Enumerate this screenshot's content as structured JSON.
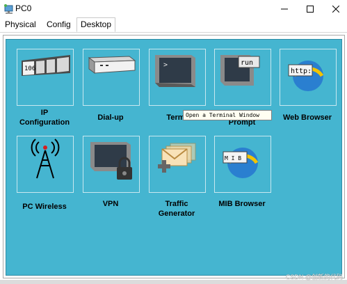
{
  "window": {
    "title": "PC0"
  },
  "tabs": [
    {
      "label": "Physical"
    },
    {
      "label": "Config"
    },
    {
      "label": "Desktop"
    }
  ],
  "active_tab": "Desktop",
  "desktop": {
    "apps": [
      {
        "id": "ip-configuration",
        "label_lines": [
          "IP",
          "Configuration"
        ],
        "icon": "ip-config-icon",
        "icon_text": "106"
      },
      {
        "id": "dial-up",
        "label_lines": [
          "Dial-up"
        ],
        "icon": "modem-icon"
      },
      {
        "id": "terminal",
        "label_lines": [
          "Termi"
        ],
        "icon": "terminal-icon",
        "icon_text": ">"
      },
      {
        "id": "command-prompt",
        "label_lines": [
          "",
          "Prompt"
        ],
        "icon": "command-prompt-icon",
        "icon_text": "run"
      },
      {
        "id": "web-browser",
        "label_lines": [
          "Web Browser"
        ],
        "icon": "web-browser-icon",
        "icon_text": "http:"
      },
      {
        "id": "pc-wireless",
        "label_lines": [
          "PC Wireless"
        ],
        "icon": "wireless-tower-icon"
      },
      {
        "id": "vpn",
        "label_lines": [
          "VPN"
        ],
        "icon": "vpn-lock-icon"
      },
      {
        "id": "traffic-generator",
        "label_lines": [
          "Traffic",
          "Generator"
        ],
        "icon": "traffic-generator-icon"
      },
      {
        "id": "mib-browser",
        "label_lines": [
          "MIB Browser"
        ],
        "icon": "mib-browser-icon",
        "icon_text": "M I B"
      }
    ],
    "tooltip": "Open a Terminal Window"
  },
  "watermark": "CSDN @创新的代码"
}
